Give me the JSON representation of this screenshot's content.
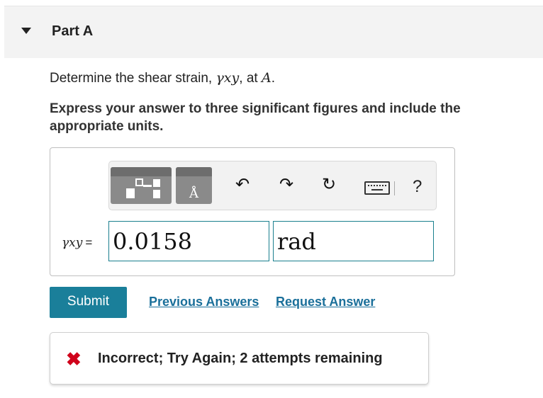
{
  "part": {
    "title": "Part A"
  },
  "question": {
    "prefix": "Determine the shear strain, ",
    "var": "γxy",
    "middle": ", at ",
    "point": "A",
    "suffix": "."
  },
  "instructions": "Express your answer to three significant figures and include the appropriate units.",
  "toolbar": {
    "units_glyph": "Å",
    "undo": "↶",
    "redo": "↷",
    "reset": "↻",
    "help": "?"
  },
  "answer": {
    "variable": "γxy",
    "equals": "=",
    "value": "0.0158",
    "unit": "rad"
  },
  "actions": {
    "submit": "Submit",
    "previous_answers": "Previous Answers",
    "request_answer": "Request Answer"
  },
  "feedback": {
    "icon": "✖",
    "message": "Incorrect; Try Again; 2 attempts remaining"
  },
  "colors": {
    "accent": "#1a7f9a",
    "error": "#d0021b",
    "input_border": "#1a7f8e"
  }
}
